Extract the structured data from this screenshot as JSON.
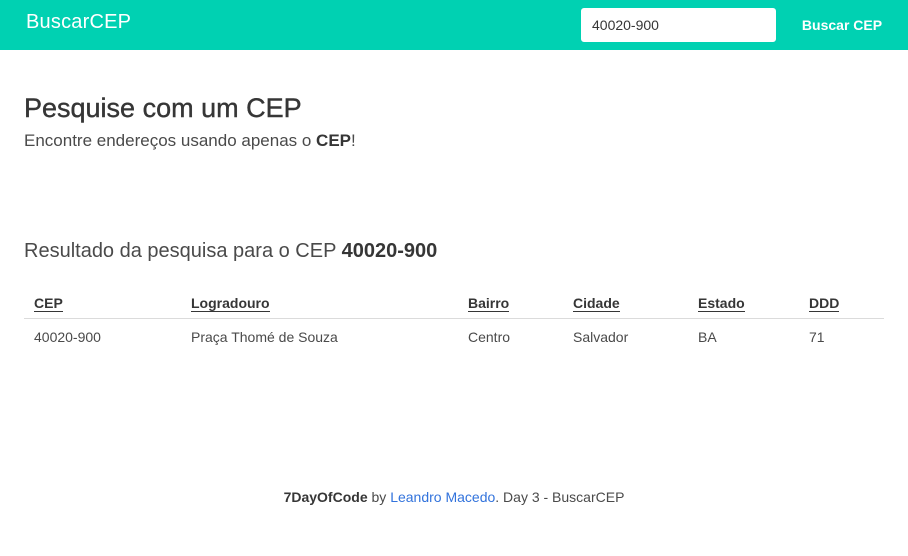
{
  "navbar": {
    "brand": "BuscarCEP",
    "search_value": "40020-900",
    "search_button": "Buscar CEP"
  },
  "hero": {
    "title": "Pesquise com um CEP",
    "subtitle_prefix": "Encontre endereços usando apenas o ",
    "subtitle_bold": "CEP",
    "subtitle_suffix": "!"
  },
  "results": {
    "heading_prefix": "Resultado da pesquisa para o CEP ",
    "heading_cep": "40020-900",
    "columns": [
      "CEP",
      "Logradouro",
      "Bairro",
      "Cidade",
      "Estado",
      "DDD"
    ],
    "rows": [
      [
        "40020-900",
        "Praça Thomé de Souza",
        "Centro",
        "Salvador",
        "BA",
        "71"
      ]
    ]
  },
  "footer": {
    "project": "7DayOfCode",
    "by": " by ",
    "author": "Leandro Macedo",
    "suffix": ". Day 3 - BuscarCEP"
  },
  "colors": {
    "accent": "#00d1b2",
    "link": "#3273dc"
  }
}
